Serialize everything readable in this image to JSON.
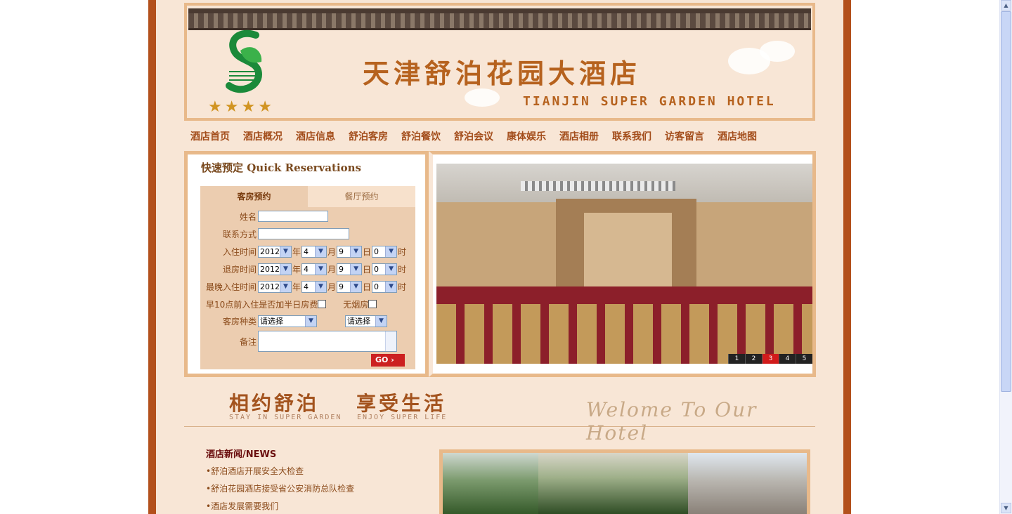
{
  "header": {
    "title_cn": "天津舒泊花园大酒店",
    "title_en": "TIANJIN SUPER GARDEN HOTEL",
    "stars": [
      "★",
      "★",
      "★",
      "★"
    ]
  },
  "nav": [
    "酒店首页",
    "酒店概况",
    "酒店信息",
    "舒泊客房",
    "舒泊餐饮",
    "舒泊会议",
    "康体娱乐",
    "酒店相册",
    "联系我们",
    "访客留言",
    "酒店地图"
  ],
  "reservation": {
    "title": "快速预定 Quick Reservations",
    "tab_room": "客房预约",
    "tab_restaurant": "餐厅预约",
    "name_label": "姓名",
    "contact_label": "联系方式",
    "checkin_label": "入住时间",
    "checkout_label": "退房时间",
    "latest_label": "最晚入住时间",
    "year": "2012",
    "month": "4",
    "day": "9",
    "hour": "0",
    "unit_year": "年",
    "unit_month": "月",
    "unit_day": "日",
    "unit_hour": "时",
    "early_checkin": "早10点前入住是否加半日房费",
    "nonsmoking": "无烟房",
    "room_type_label": "客房种类",
    "select_placeholder": "请选择",
    "remark_label": "备注",
    "go": "GO ›"
  },
  "slideshow": {
    "pages": [
      "1",
      "2",
      "3",
      "4",
      "5"
    ],
    "active": "3"
  },
  "slogan": {
    "cn1": "相约舒泊",
    "en1": "STAY IN SUPER GARDEN",
    "cn2": "享受生活",
    "en2": "ENJOY SUPER LIFE",
    "welcome": "Welome To Our Hotel"
  },
  "news": {
    "title": "酒店新闻/NEWS",
    "items": [
      "•舒泊酒店开展安全大检查",
      "•舒泊花园酒店接受省公安消防总队检查",
      "•酒店发展需要我们"
    ]
  },
  "colors": {
    "frame": "#b3501c",
    "bg": "#f8e6d6",
    "border": "#e8b98a",
    "accent": "#a34d1b"
  }
}
